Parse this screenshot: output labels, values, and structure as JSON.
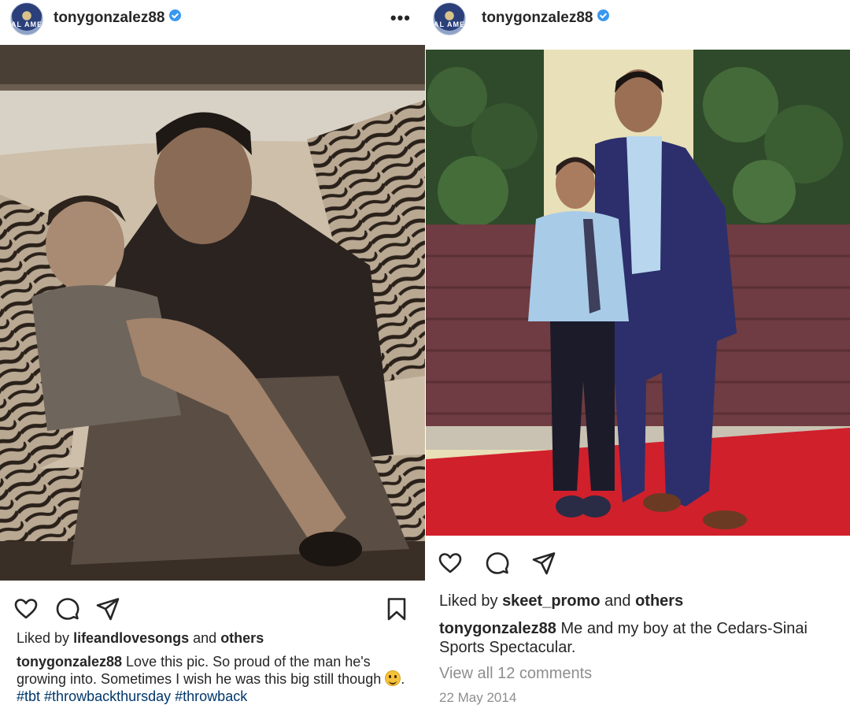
{
  "posts": [
    {
      "username": "tonygonzalez88",
      "avatar_text": "AL AME",
      "more_label": "•••",
      "photo_desc": "sepia photo: father and young son on tiger-print couch",
      "liked_by_prefix": "Liked by",
      "liked_by_user": "lifeandlovesongs",
      "liked_by_and": "and",
      "liked_by_others": "others",
      "caption_user": "tonygonzalez88",
      "caption_text_1": "Love this pic. So proud of the man he's growing into. Sometimes I wish he was this big still though",
      "caption_text_2": ".",
      "hashtags": [
        "#tbt",
        "#throwbackthursday",
        "#throwback"
      ],
      "icons": [
        "heart-icon",
        "comment-icon",
        "share-icon",
        "bookmark-icon"
      ]
    },
    {
      "username": "tonygonzalez88",
      "avatar_text": "AL AME",
      "photo_desc": "color photo: father and son on a red carpet",
      "liked_by_prefix": "Liked by",
      "liked_by_user": "skeet_promo",
      "liked_by_and": "and",
      "liked_by_others": "others",
      "caption_user": "tonygonzalez88",
      "caption_text": "Me and my boy at the Cedars-Sinai Sports Spectacular.",
      "view_comments": "View all 12 comments",
      "date": "22 May 2014",
      "icons": [
        "heart-icon",
        "comment-icon",
        "share-icon"
      ]
    }
  ],
  "colors": {
    "verified": "#3897f0",
    "hashtag": "#00376b",
    "muted": "#8e8e8e",
    "text": "#262626"
  }
}
